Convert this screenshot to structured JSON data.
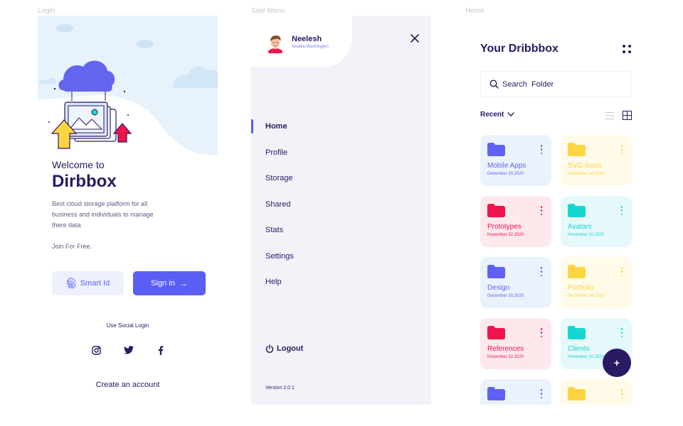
{
  "frames": {
    "login": "Login",
    "side_menu": "Side Menu",
    "home": "Home"
  },
  "login": {
    "welcome": "Welcome to",
    "brand": "Dirbbox",
    "description": "Best cloud storage platform for all business and individuals to manage there data",
    "join": "Join For Free.",
    "smart_id_label": "Smart Id",
    "signin_label": "Sign in",
    "social_label": "Use Social Login",
    "social_icons": [
      "instagram-icon",
      "twitter-icon",
      "facebook-icon"
    ],
    "create_account": "Create an account"
  },
  "menu": {
    "user_name": "Neelesh",
    "user_location": "Seattle,Washington",
    "items": [
      {
        "label": "Home",
        "active": true
      },
      {
        "label": "Profile",
        "active": false
      },
      {
        "label": "Storage",
        "active": false
      },
      {
        "label": "Shared",
        "active": false
      },
      {
        "label": "Stats",
        "active": false
      },
      {
        "label": "Settings",
        "active": false
      },
      {
        "label": "Help",
        "active": false
      }
    ],
    "logout_label": "Logout",
    "version": "Version 2.0.1"
  },
  "home": {
    "title": "Your Dribbbox",
    "search_placeholder": "Search  Folder",
    "recent_label": "Recent",
    "folders": [
      {
        "name": "Mobile Apps",
        "date": "December 20.2020",
        "color": "#6061f3",
        "bg": "#eaf3fd"
      },
      {
        "name": "SVG Icons",
        "date": "December 14.2020",
        "color": "#fed440",
        "bg": "#fffbe8"
      },
      {
        "name": "Prototypes",
        "date": "November 22.2020",
        "color": "#f2144d",
        "bg": "#fde9ec"
      },
      {
        "name": "Avatars",
        "date": "November 10.2020",
        "color": "#17d6d2",
        "bg": "#e6f9fa"
      },
      {
        "name": "Design",
        "date": "December 20.2020",
        "color": "#6061f3",
        "bg": "#eaf3fd"
      },
      {
        "name": "Portfolio",
        "date": "December 14.2020",
        "color": "#fed440",
        "bg": "#fffbe8"
      },
      {
        "name": "References",
        "date": "November 22.2020",
        "color": "#f2144d",
        "bg": "#fde9ec"
      },
      {
        "name": "Clients",
        "date": "November 10.2020",
        "color": "#17d6d2",
        "bg": "#e6f9fa"
      },
      {
        "name": "",
        "date": "",
        "color": "#6061f3",
        "bg": "#eaf3fd"
      },
      {
        "name": "",
        "date": "",
        "color": "#fed440",
        "bg": "#fffbe8"
      }
    ],
    "fab_label": "+"
  }
}
